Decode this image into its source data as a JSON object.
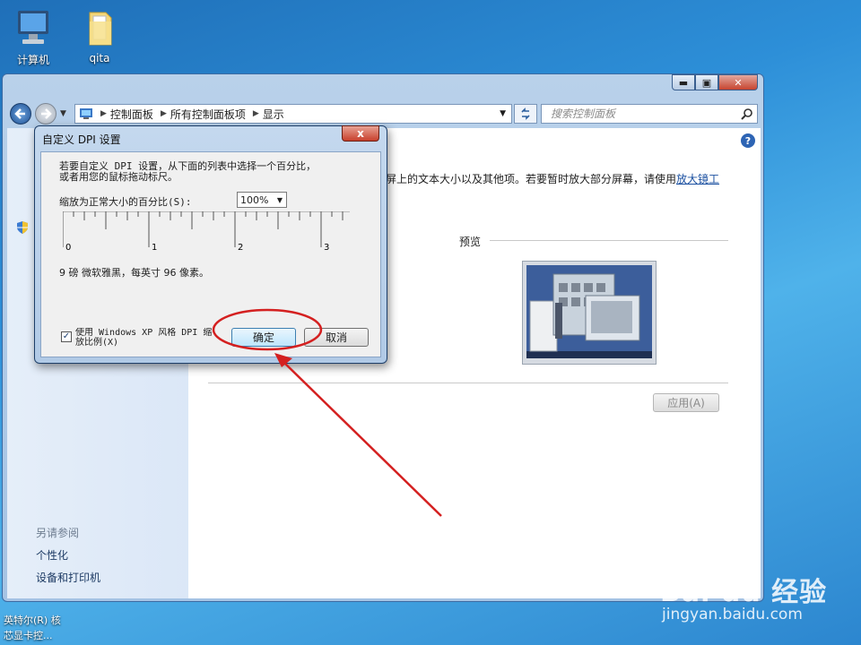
{
  "desktop": {
    "icons": [
      {
        "label": "计算机",
        "icon": "computer-icon"
      },
      {
        "label": "qita",
        "icon": "folder-icon"
      }
    ],
    "taskbar_text": [
      "英特尔(R) 核",
      "芯显卡控..."
    ]
  },
  "window": {
    "controls": {
      "minimize": "▬",
      "maximize": "▣",
      "close": "✕"
    },
    "breadcrumb": [
      "控制面板",
      "所有控制面板项",
      "显示"
    ],
    "search_placeholder": "搜索控制面板",
    "help": "?",
    "description_text": "屏上的文本大小以及其他项。若要暂时放大部分屏幕，请使用",
    "magnifier_link": "放大镜工",
    "preview_label": "预览",
    "apply_button": "应用(A)",
    "sidebar": {
      "see_also": "另请参阅",
      "links": [
        "个性化",
        "设备和打印机"
      ]
    }
  },
  "dialog": {
    "title": "自定义 DPI 设置",
    "close": "x",
    "instruction_line1": "若要自定义 DPI 设置，从下面的列表中选择一个百分比，",
    "instruction_line2": "或者用您的鼠标拖动标尺。",
    "scale_label": "缩放为正常大小的百分比(S):",
    "scale_value": "100%",
    "ruler_labels": [
      "0",
      "1",
      "2",
      "3"
    ],
    "font_sample": "9 磅 微软雅黑，每英寸 96 像素。",
    "checkbox_line1": "使用 Windows XP 风格 DPI 缩",
    "checkbox_line2": "放比例(X)",
    "checkbox_checked": true,
    "ok_button": "确定",
    "cancel_button": "取消"
  },
  "watermark": {
    "brand": "Bai du 经验",
    "url": "jingyan.baidu.com"
  },
  "colors": {
    "annotation": "#d42020",
    "link": "#1a4fa0",
    "desktop": "#2d8fd8"
  }
}
